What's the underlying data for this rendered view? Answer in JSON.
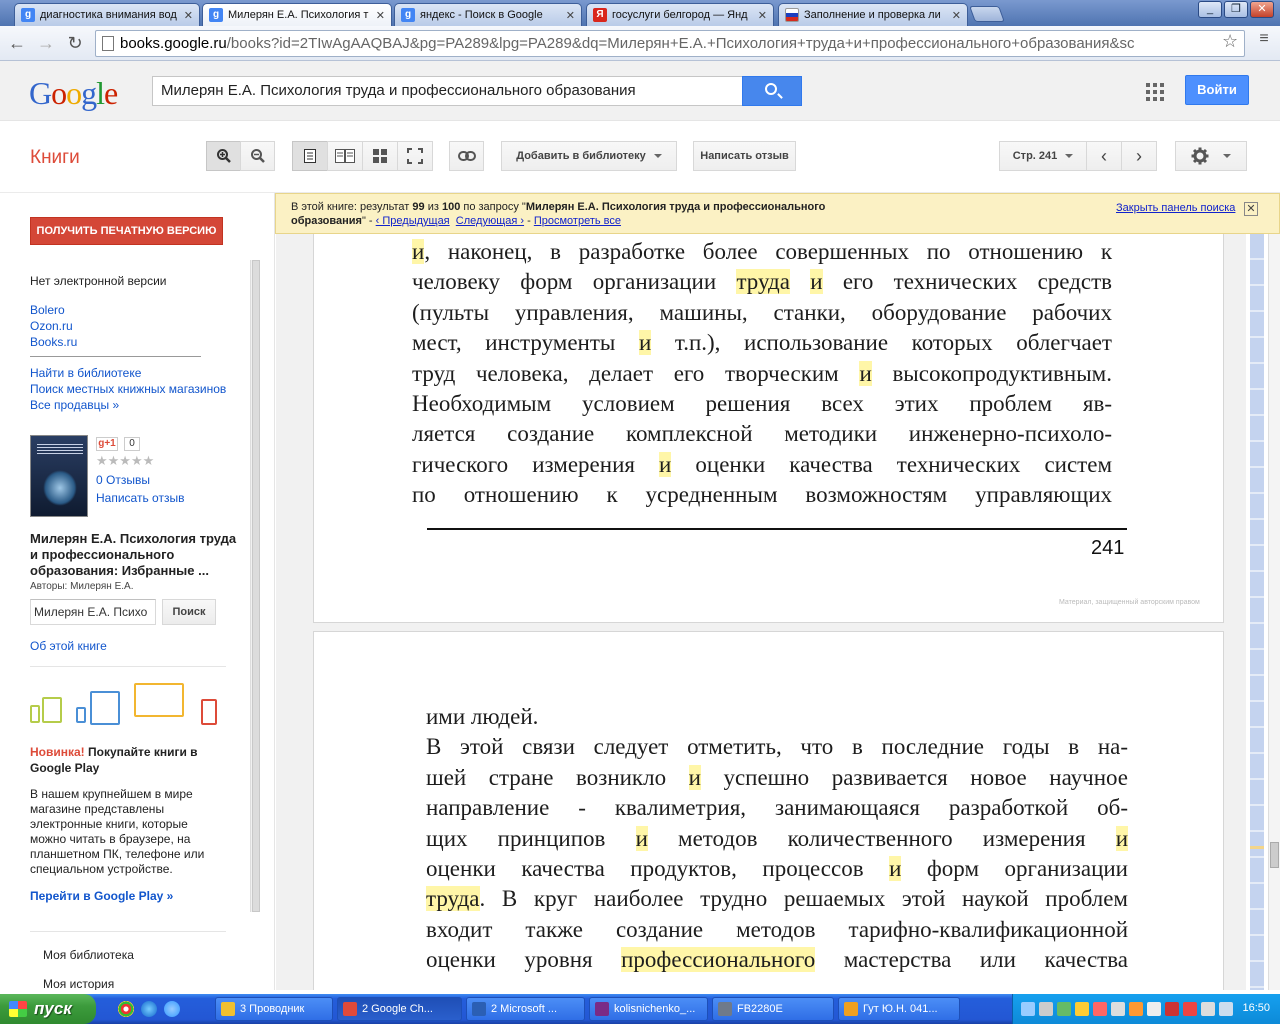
{
  "browser": {
    "tabs": [
      {
        "label": "диагностика внимания вод",
        "favicon": "g",
        "favicon_color": "#4285f4"
      },
      {
        "label": "Милерян Е.А. Психология т",
        "favicon": "g",
        "favicon_color": "#4285f4"
      },
      {
        "label": "яндекс - Поиск в Google",
        "favicon": "g",
        "favicon_color": "#4285f4"
      },
      {
        "label": "госуслуги белгород — Янд",
        "favicon": "Я",
        "favicon_color": "#d9261c"
      },
      {
        "label": "Заполнение и проверка ли",
        "favicon": "",
        "favicon_color": "#d52b1e"
      }
    ],
    "url_domain": "books.google.ru",
    "url_rest": "/books?id=2TIwAgAAQBAJ&pg=PA289&lpg=PA289&dq=Милерян+Е.А.+Психология+труда+и+профессионального+образования&sc"
  },
  "google": {
    "logo": [
      "G",
      "o",
      "o",
      "g",
      "l",
      "e"
    ],
    "search_value": "Милерян Е.А. Психология труда и профессионального образования",
    "signin_label": "Войти"
  },
  "books_toolbar": {
    "title": "Книги",
    "add_library": "Добавить в библиотеку",
    "write_review": "Написать отзыв",
    "page_label": "Стр. 241"
  },
  "notice": {
    "prefix": "В этой книге: результат ",
    "current": "99",
    "of": " из ",
    "total": "100",
    "by_query": " по запросу \"",
    "query_line1": "Милерян Е.А. Психология труда и профессионального",
    "query_line2": "образования",
    "suffix": "\" - ",
    "prev": "‹ Предыдущая",
    "next": "Следующая ›",
    "dash": " - ",
    "view_all": "Просмотреть все",
    "close": "Закрыть панель поиска"
  },
  "sidebar": {
    "print_button": "ПОЛУЧИТЬ ПЕЧАТНУЮ ВЕРСИЮ",
    "no_ebook": "Нет электронной версии",
    "shops": [
      "Bolero",
      "Ozon.ru",
      "Books.ru"
    ],
    "find_library": "Найти в библиотеке",
    "local_stores": "Поиск местных книжных магазинов",
    "all_sellers": "Все продавцы »",
    "gplus": "g+1",
    "gplus_count": "0",
    "stars": "★★★★★",
    "reviews_count": "0 Отзывы",
    "write_review": "Написать отзыв",
    "book_title": "Милерян Е.А. Психология труда и профессионального образования: Избранные ...",
    "authors": "Авторы: Милерян Е.А.",
    "search_in_book_value": "Милерян Е.А. Психо",
    "search_button": "Поиск",
    "about_book": "Об этой книге",
    "play_new": "Новинка!",
    "play_headline": " Покупайте книги в Google Play",
    "play_desc": "В нашем крупнейшем в мире магазине представлены электронные книги, которые можно читать в браузере, на планшетном ПК, телефоне или специальном устройстве.",
    "play_link": "Перейти в Google Play »",
    "my_library": "Моя библиотека",
    "my_history": "Моя история"
  },
  "page1": {
    "lines": [
      [
        {
          "t": "и",
          "h": true
        },
        {
          "t": ", наконец, в разработке более совершенных по отношению к"
        }
      ],
      [
        {
          "t": "человеку форм организации "
        },
        {
          "t": "труда",
          "h": true
        },
        {
          "t": " "
        },
        {
          "t": "и",
          "h": true
        },
        {
          "t": " его технических средств"
        }
      ],
      [
        {
          "t": "(пульты управления, машины, станки, оборудование рабочих"
        }
      ],
      [
        {
          "t": "мест, инструменты "
        },
        {
          "t": "и",
          "h": true
        },
        {
          "t": " т.п.), использование которых облегчает"
        }
      ],
      [
        {
          "t": "труд человека, делает его творческим "
        },
        {
          "t": "и",
          "h": true
        },
        {
          "t": " высокопродуктивным."
        }
      ],
      [
        {
          "t": "   Необходимым условием решения всех этих проблем яв-"
        }
      ],
      [
        {
          "t": "ляется создание комплексной методики инженерно-психоло-"
        }
      ],
      [
        {
          "t": "гического измерения "
        },
        {
          "t": "и",
          "h": true
        },
        {
          "t": " оценки качества технических систем"
        }
      ],
      [
        {
          "t": "по отношению к усредненным возможностям управляющих"
        }
      ]
    ],
    "page_number": "241",
    "copyright": "Материал, защищенный авторским правом"
  },
  "page2": {
    "lines": [
      [
        {
          "t": "ими людей."
        }
      ],
      [
        {
          "t": "   В этой связи следует отметить, что в последние годы в на-"
        }
      ],
      [
        {
          "t": "шей стране возникло "
        },
        {
          "t": "и",
          "h": true
        },
        {
          "t": " успешно развивается новое научное"
        }
      ],
      [
        {
          "t": "направление - квалиметрия, занимающаяся разработкой об-"
        }
      ],
      [
        {
          "t": "щих принципов "
        },
        {
          "t": "и",
          "h": true
        },
        {
          "t": " методов количественного измерения "
        },
        {
          "t": "и",
          "h": true
        }
      ],
      [
        {
          "t": "оценки качества продуктов, процессов "
        },
        {
          "t": "и",
          "h": true
        },
        {
          "t": " форм организации"
        }
      ],
      [
        {
          "t": "труда",
          "h": true
        },
        {
          "t": ". В круг наиболее трудно решаемых этой наукой проблем"
        }
      ],
      [
        {
          "t": "входит также создание методов тарифно-квалификационной"
        }
      ],
      [
        {
          "t": "оценки уровня "
        },
        {
          "t": "профессионального",
          "h": true
        },
        {
          "t": " мастерства или качества"
        }
      ]
    ]
  },
  "taskbar": {
    "start": "пуск",
    "tasks": [
      {
        "label": "3 Проводник",
        "color": "#f0c030"
      },
      {
        "label": "2 Google Ch...",
        "color": "#e04a3a"
      },
      {
        "label": "2 Microsoft ...",
        "color": "#2b5fb4"
      },
      {
        "label": "kolisnichenko_...",
        "color": "#7a2b86"
      },
      {
        "label": "FB2280E",
        "color": "#6f7a8a"
      },
      {
        "label": "Гут Ю.Н. 041...",
        "color": "#f0a020"
      }
    ],
    "clock": "16:50"
  }
}
